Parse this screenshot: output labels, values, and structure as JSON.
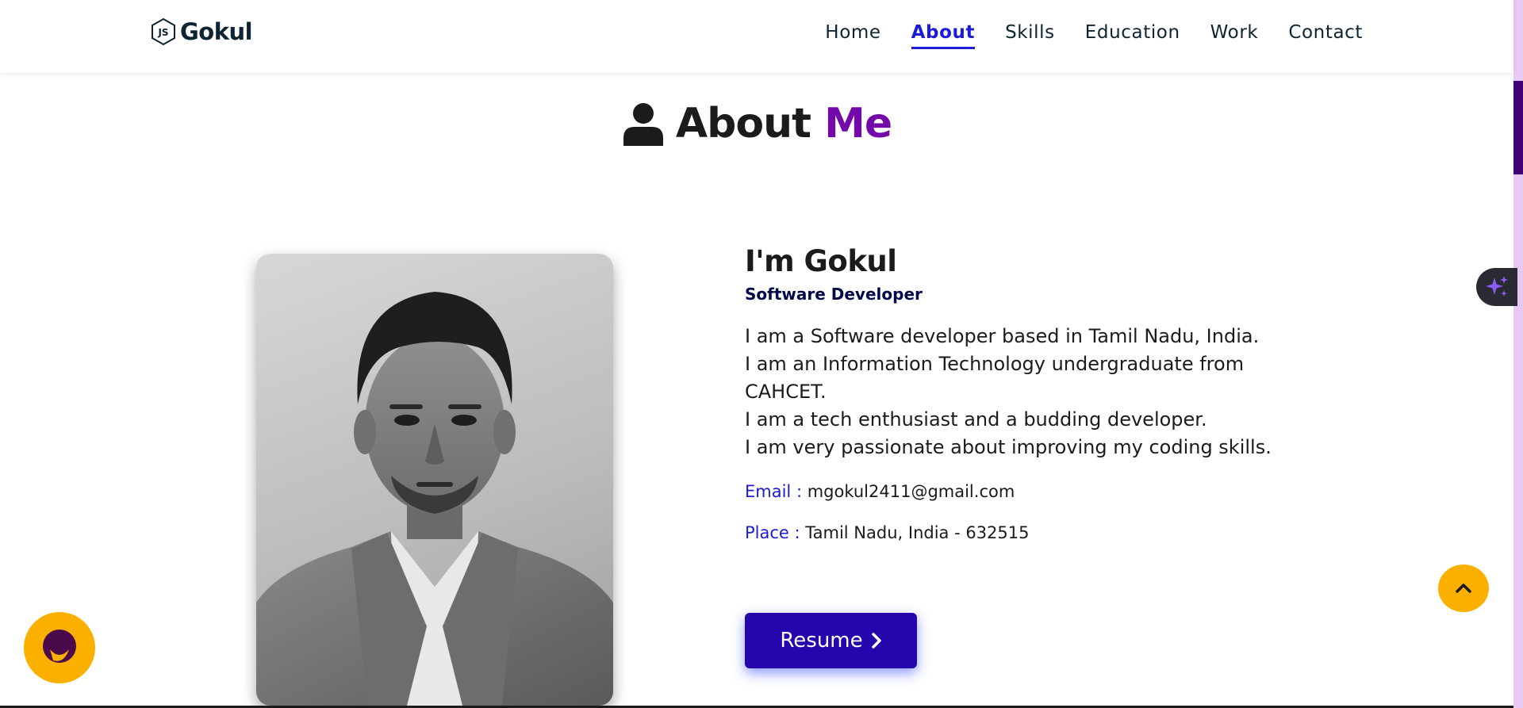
{
  "header": {
    "logo_text": "Gokul",
    "logo_icon": "nodejs-hexagon-icon",
    "nav": [
      {
        "label": "Home",
        "active": false
      },
      {
        "label": "About",
        "active": true
      },
      {
        "label": "Skills",
        "active": false
      },
      {
        "label": "Education",
        "active": false
      },
      {
        "label": "Work",
        "active": false
      },
      {
        "label": "Contact",
        "active": false
      }
    ]
  },
  "about": {
    "heading_icon": "user-icon",
    "heading_main": "About",
    "heading_accent": "Me",
    "name": "I'm Gokul",
    "role": "Software Developer",
    "bio_lines": [
      "I am a Software developer based in Tamil Nadu, India.",
      "I am an Information Technology undergraduate from",
      "CAHCET.",
      "I am a tech enthusiast and a budding developer.",
      "I am very passionate about improving my coding skills."
    ],
    "email_label": "Email :",
    "email_value": "mgokul2411@gmail.com",
    "place_label": "Place :",
    "place_value": "Tamil Nadu, India - 632515",
    "resume_label": "Resume",
    "resume_icon": "chevron-right-icon"
  },
  "widgets": {
    "ai_icon": "sparkle-icon",
    "scroll_top_icon": "chevron-up-icon",
    "chat_icon": "chat-bubble-icon"
  },
  "colors": {
    "accent_purple": "#7209a8",
    "nav_active": "#1c1cd6",
    "resume_button": "#2506ad",
    "widget_yellow": "#fbb000",
    "scrollbar_thumb": "#420177",
    "scrollbar_track": "#e7c9f5"
  }
}
